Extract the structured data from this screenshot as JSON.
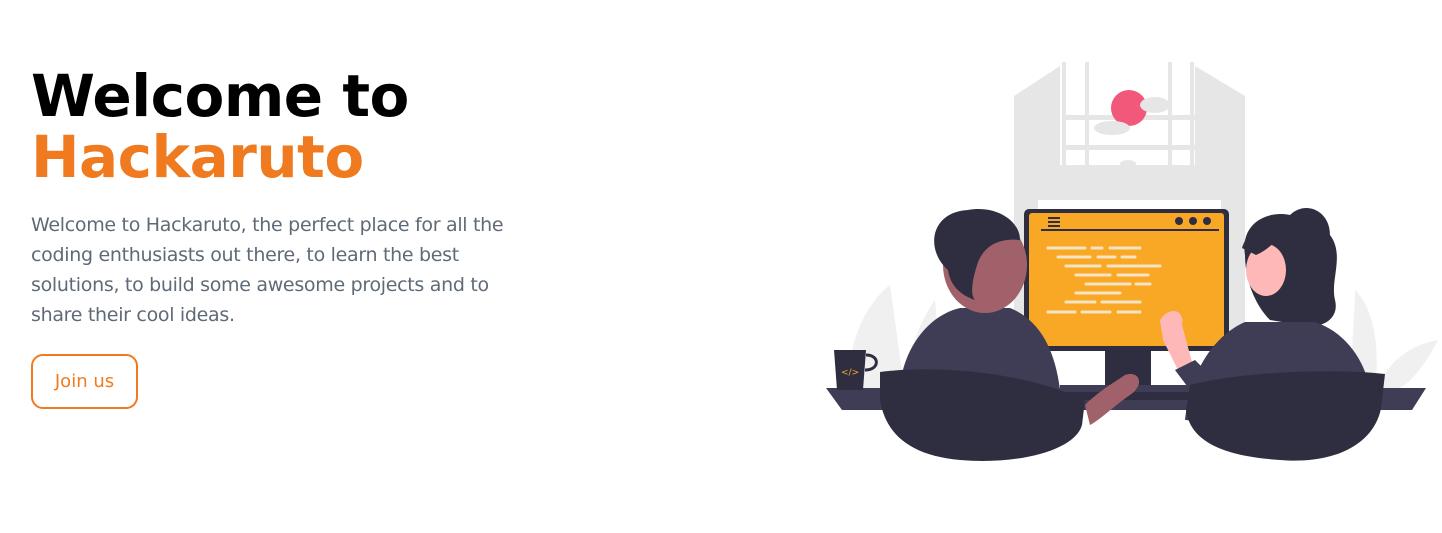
{
  "hero": {
    "title_line1": "Welcome to",
    "title_line2": "Hackaruto",
    "description": "Welcome to Hackaruto, the perfect place for all the coding enthusiasts out there, to learn the best solutions, to build some awesome projects and to share their cool ideas.",
    "cta_label": "Join us"
  },
  "colors": {
    "accent": "#f07a1f",
    "title": "#000000",
    "text": "#5f6a77",
    "screen": "#f9a826",
    "dark": "#2f2e41",
    "sun": "#f2587a"
  },
  "illustration": {
    "icon": "coding-illustration-icon",
    "mug_glyph": "</>"
  }
}
